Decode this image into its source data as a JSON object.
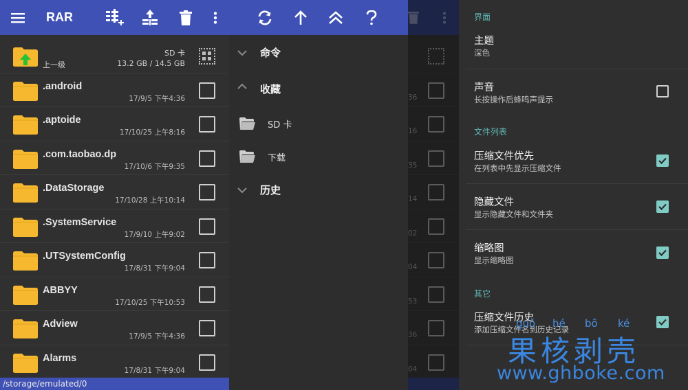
{
  "app": {
    "title": "RAR"
  },
  "toolbar_left": {
    "menu_icon": "hamburger-icon",
    "add_archive_icon": "add-to-archive-icon",
    "extract_icon": "extract-icon",
    "delete_icon": "trash-icon",
    "more_icon": "more-vert-icon"
  },
  "toolbar_mid": {
    "refresh_icon": "refresh-icon",
    "up_icon": "arrow-up-icon",
    "root_icon": "double-chevron-up-icon",
    "help_icon": "help-icon"
  },
  "file_list": {
    "parent": {
      "label": "上一级",
      "storage": "SD 卡",
      "size": "13.2 GB / 14.5 GB"
    },
    "items": [
      {
        "name": ".android",
        "date": "17/9/5 下午4:36"
      },
      {
        "name": ".aptoide",
        "date": "17/10/25 上午8:16"
      },
      {
        "name": ".com.taobao.dp",
        "date": "17/10/6 下午9:35"
      },
      {
        "name": ".DataStorage",
        "date": "17/10/28 上午10:14"
      },
      {
        "name": ".SystemService",
        "date": "17/9/10 上午9:02"
      },
      {
        "name": ".UTSystemConfig",
        "date": "17/8/31 下午9:04"
      },
      {
        "name": "ABBYY",
        "date": "17/10/25 下午10:53"
      },
      {
        "name": "Adview",
        "date": "17/9/5 下午4:36"
      },
      {
        "name": "Alarms",
        "date": "17/8/31 下午9:04"
      }
    ],
    "path": "/storage/emulated/0"
  },
  "drawer": {
    "commands": "命令",
    "favorites": "收藏",
    "fav_items": [
      "SD 卡",
      "下载"
    ],
    "history": "历史"
  },
  "dim_strip": {
    "dates": [
      "36",
      "16",
      "35",
      "14",
      "02",
      "04",
      "53",
      "36",
      "04"
    ]
  },
  "settings": {
    "sections": {
      "interface": "界面",
      "file_list": "文件列表",
      "other": "其它"
    },
    "theme": {
      "title": "主题",
      "value": "深色"
    },
    "sound": {
      "title": "声音",
      "sub": "长按操作后蜂鸣声提示",
      "checked": false
    },
    "archives_first": {
      "title": "压缩文件优先",
      "sub": "在列表中先显示压缩文件",
      "checked": true
    },
    "hidden_files": {
      "title": "隐藏文件",
      "sub": "显示隐藏文件和文件夹",
      "checked": true
    },
    "thumbnails": {
      "title": "缩略图",
      "sub": "显示缩略图",
      "checked": true
    },
    "archive_history": {
      "title": "压缩文件历史",
      "sub": "添加压缩文件名到历史记录",
      "checked": true
    }
  },
  "watermark": {
    "pinyin": [
      "guǒ",
      "hé",
      "bō",
      "ké"
    ],
    "chinese": "果核剥壳",
    "url": "www.ghboke.com"
  },
  "colors": {
    "appbar": "#3f51b5",
    "accent": "#80cbc4",
    "folder": "#f5b82e"
  }
}
